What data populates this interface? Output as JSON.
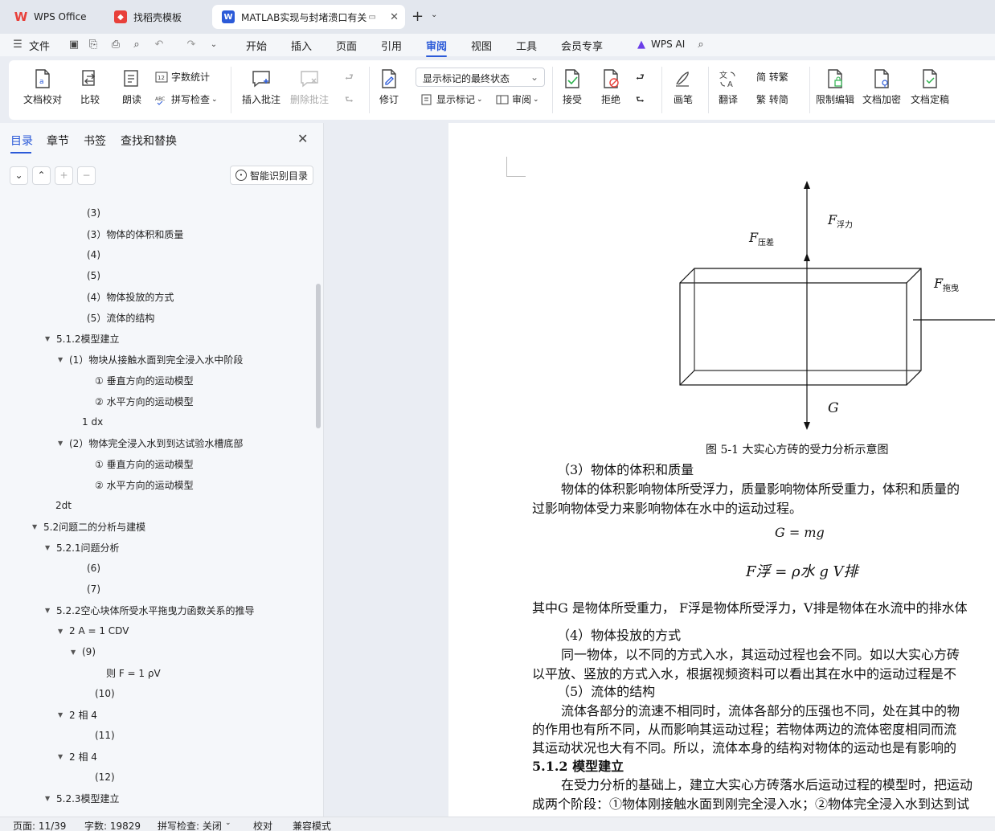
{
  "tabs": [
    {
      "label": "WPS Office"
    },
    {
      "label": "找稻壳模板"
    },
    {
      "label": "MATLAB实现与封堵溃口有关"
    }
  ],
  "menu": {
    "file": "文件",
    "items": [
      "开始",
      "插入",
      "页面",
      "引用",
      "审阅",
      "视图",
      "工具",
      "会员专享"
    ],
    "active": "审阅",
    "wps_ai": "WPS AI"
  },
  "ribbon": {
    "doc_check": "文档校对",
    "compare": "比较",
    "read": "朗读",
    "word_count": "字数统计",
    "spell_check": "拼写检查",
    "insert_comment": "插入批注",
    "delete_comment": "删除批注",
    "revise": "修订",
    "display_mode": "显示标记的最终状态",
    "show_markup": "显示标记",
    "review_pane": "审阅",
    "accept": "接受",
    "reject": "拒绝",
    "pen": "画笔",
    "translate": "翻译",
    "trad_convert": "简 转繁",
    "simp_convert": "繁 转简",
    "restrict_edit": "限制编辑",
    "encrypt": "文档加密",
    "finalize": "文档定稿"
  },
  "sidebar": {
    "tabs": [
      "目录",
      "章节",
      "书签",
      "查找和替换"
    ],
    "smart_toc": "智能识别目录",
    "toc": [
      {
        "text": "(3)",
        "indent": 5,
        "arrow": ""
      },
      {
        "text": "(3）物体的体积和质量",
        "indent": 5,
        "arrow": ""
      },
      {
        "text": "(4)",
        "indent": 5,
        "arrow": ""
      },
      {
        "text": "(5)",
        "indent": 5,
        "arrow": ""
      },
      {
        "text": "(4）物体投放的方式",
        "indent": 5,
        "arrow": ""
      },
      {
        "text": "(5）流体的结构",
        "indent": 5,
        "arrow": ""
      },
      {
        "text": "5.1.2模型建立",
        "indent": 2,
        "arrow": "▼"
      },
      {
        "text": "(1）物块从接触水面到完全浸入水中阶段",
        "indent": 3,
        "arrow": "▼"
      },
      {
        "text": "① 垂直方向的运动模型",
        "indent": 6,
        "arrow": ""
      },
      {
        "text": "② 水平方向的运动模型",
        "indent": 6,
        "arrow": ""
      },
      {
        "text": "1 dx",
        "indent": 4,
        "arrow": ""
      },
      {
        "text": "(2）物体完全浸入水到到达试验水槽底部",
        "indent": 3,
        "arrow": "▼"
      },
      {
        "text": "① 垂直方向的运动模型",
        "indent": 6,
        "arrow": ""
      },
      {
        "text": "② 水平方向的运动模型",
        "indent": 6,
        "arrow": ""
      },
      {
        "text": "2dt",
        "indent": 0,
        "arrow": ""
      },
      {
        "text": "5.2问题二的分析与建模",
        "indent": 1,
        "arrow": "▼"
      },
      {
        "text": "5.2.1问题分析",
        "indent": 2,
        "arrow": "▼"
      },
      {
        "text": "(6)",
        "indent": 5,
        "arrow": ""
      },
      {
        "text": "(7)",
        "indent": 5,
        "arrow": ""
      },
      {
        "text": "5.2.2空心块体所受水平拖曳力函数关系的推导",
        "indent": 2,
        "arrow": "▼"
      },
      {
        "text": "2 A = 1 CDV",
        "indent": 3,
        "arrow": "▼"
      },
      {
        "text": "(9)",
        "indent": 4,
        "arrow": "▼"
      },
      {
        "text": "则 F = 1 ρV",
        "indent": 7,
        "arrow": ""
      },
      {
        "text": "(10)",
        "indent": 6,
        "arrow": ""
      },
      {
        "text": "2 相 4",
        "indent": 3,
        "arrow": "▼"
      },
      {
        "text": "(11)",
        "indent": 6,
        "arrow": ""
      },
      {
        "text": "2 相 4",
        "indent": 3,
        "arrow": "▼"
      },
      {
        "text": "(12)",
        "indent": 6,
        "arrow": ""
      },
      {
        "text": "5.2.3模型建立",
        "indent": 2,
        "arrow": "▼"
      }
    ]
  },
  "document": {
    "diagram_labels": {
      "buoyancy_F": "F",
      "buoyancy_sub": "浮力",
      "pressure_F": "F",
      "pressure_sub": "压差",
      "drag_F": "F",
      "drag_sub": "拖曳",
      "gravity": "G"
    },
    "caption": "图 5-1 大实心方砖的受力分析示意图",
    "lines": [
      "（3）物体的体积和质量",
      "物体的体积影响物体所受浮力，质量影响物体所受重力，体积和质量的",
      "过影响物体受力来影响物体在水中的运动过程。",
      "G = mg",
      "F浮 =  ρ水 g V排",
      "其中G 是物体所受重力，  F浮是物体所受浮力，V排是物体在水流中的排水体",
      "（4）物体投放的方式",
      "同一物体，以不同的方式入水，其运动过程也会不同。如以大实心方砖",
      "以平放、竖放的方式入水，根据视频资料可以看出其在水中的运动过程是不",
      "（5）流体的结构",
      "流体各部分的流速不相同时，流体各部分的压强也不同，处在其中的物",
      "的作用也有所不同，从而影响其运动过程；若物体两边的流体密度相同而流",
      "其运动状况也大有不同。所以，流体本身的结构对物体的运动也是有影响的",
      "5.1.2 模型建立",
      "在受力分析的基础上，建立大实心方砖落水后运动过程的模型时，把运动",
      "成两个阶段：①物体刚接触水面到刚完全浸入水；②物体完全浸入水到达到试"
    ]
  },
  "status": {
    "page": "页面: 11/39",
    "words": "字数: 19829",
    "spell": "拼写检查: 关闭",
    "proof": "校对",
    "compat": "兼容模式"
  }
}
